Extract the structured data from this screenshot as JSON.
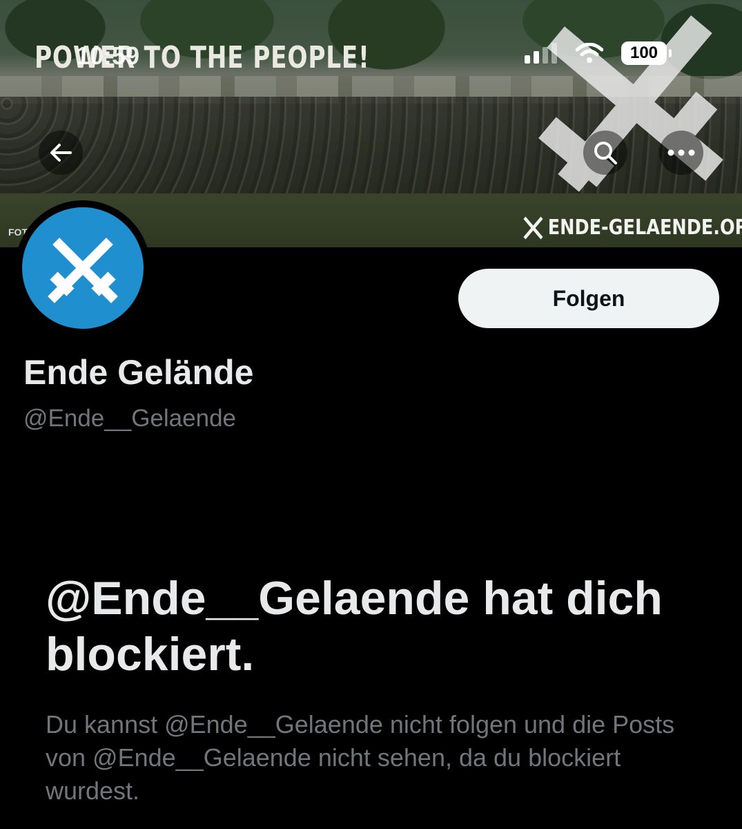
{
  "status_bar": {
    "time": "10:59",
    "battery": "100"
  },
  "banner": {
    "slogan": "POWER TO THE PEOPLE!",
    "url": "ENDE-GELAENDE.ORG",
    "credit": "FOT"
  },
  "nav": {
    "back_icon": "arrow-left-icon",
    "search_icon": "search-icon",
    "more_icon": "more-dots-icon"
  },
  "profile": {
    "display_name": "Ende Gelände",
    "handle": "@Ende__Gelaende",
    "avatar_color": "#1f8fd0",
    "follow_label": "Folgen"
  },
  "blocked": {
    "title": "@Ende__Gelaende hat dich blockiert.",
    "description": "Du kannst @Ende__Gelaende nicht folgen und die Posts von @Ende__Gelaende nicht sehen, da du blockiert wurdest."
  }
}
